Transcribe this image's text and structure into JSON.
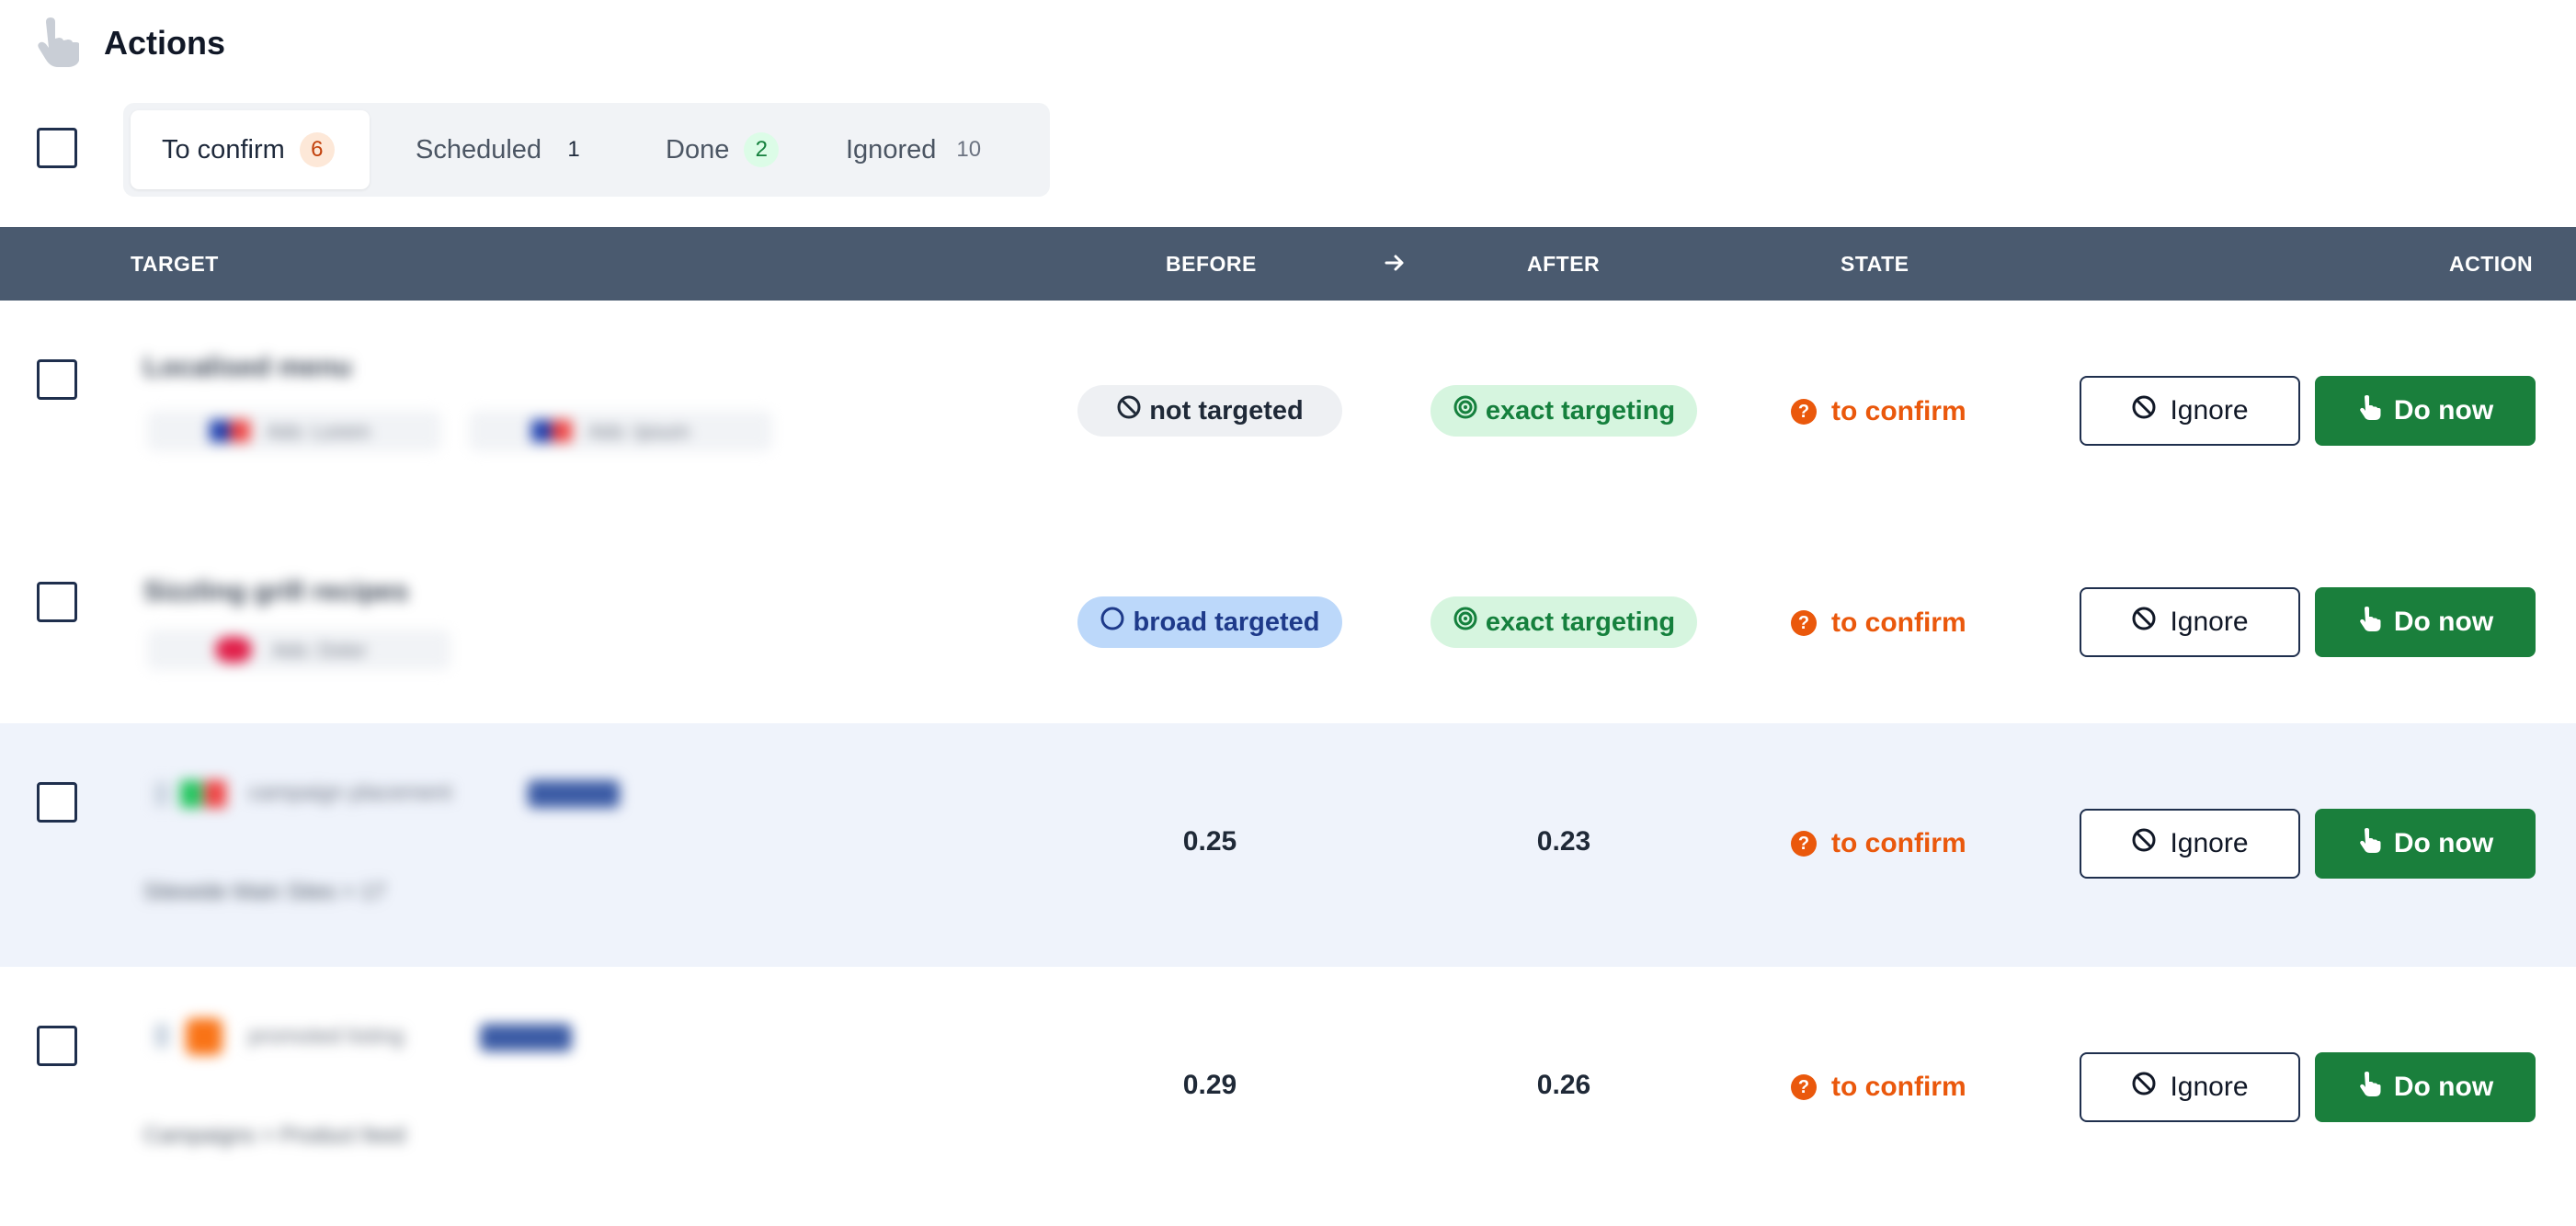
{
  "page": {
    "title": "Actions"
  },
  "tabs": [
    {
      "label": "To confirm",
      "count": "6",
      "count_bg": "#fde8d8",
      "count_color": "#c2410c"
    },
    {
      "label": "Scheduled",
      "count": "1",
      "count_bg": "transparent",
      "count_color": "#1e293b"
    },
    {
      "label": "Done",
      "count": "2",
      "count_bg": "#dcfce7",
      "count_color": "#15803d"
    },
    {
      "label": "Ignored",
      "count": "10",
      "count_bg": "transparent",
      "count_color": "#6b7280"
    }
  ],
  "table": {
    "headers": {
      "target": "TARGET",
      "before": "BEFORE",
      "after": "AFTER",
      "state": "STATE",
      "action": "ACTION"
    }
  },
  "rows": [
    {
      "target_title": "Localised menu",
      "target_meta_a": "Ads: Lorem",
      "target_meta_b": "Ads: Ipsum",
      "before": "not targeted",
      "after": "exact targeting",
      "state": "to confirm",
      "ignore_label": "Ignore",
      "do_label": "Do now"
    },
    {
      "target_title": "Sizzling grill recipes",
      "target_meta_a": "Ads: Dolor",
      "before": "broad targeted",
      "after": "exact targeting",
      "state": "to confirm",
      "ignore_label": "Ignore",
      "do_label": "Do now"
    },
    {
      "target_title": "campaign placement",
      "target_meta_a": "Sitewide Main Sites > 17",
      "before": "0.25",
      "after": "0.23",
      "state": "to confirm",
      "ignore_label": "Ignore",
      "do_label": "Do now"
    },
    {
      "target_title": "promoted listing",
      "target_meta_a": "Campaigns > Product feed",
      "before": "0.29",
      "after": "0.26",
      "state": "to confirm",
      "ignore_label": "Ignore",
      "do_label": "Do now"
    }
  ],
  "colors": {
    "header_bg": "#4a5a6f",
    "accent_green": "#1a7f3c",
    "state_orange": "#ea580c",
    "selected_row_bg": "#eff3fb",
    "navy_border": "#1f2f4d"
  },
  "icons": {
    "logo": "pointing-hand-icon",
    "arrow": "arrow-right-icon",
    "not_targeted": "ban-icon",
    "broad": "circle-icon",
    "exact": "target-icon",
    "state": "question-icon",
    "ignore": "ban-icon",
    "do": "pointing-hand-icon"
  }
}
